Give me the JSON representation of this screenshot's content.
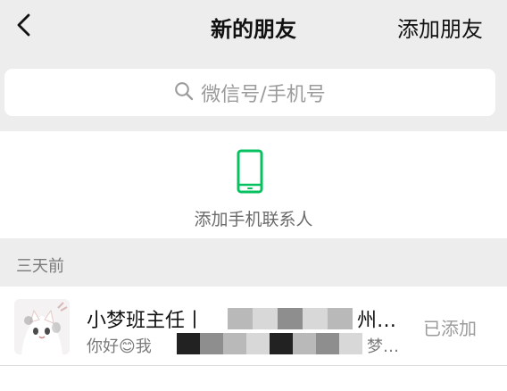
{
  "header": {
    "back_icon": "chevron-left-icon",
    "title": "新的朋友",
    "add_friend_label": "添加朋友"
  },
  "search": {
    "icon": "search-icon",
    "placeholder": "微信号/手机号"
  },
  "contacts_entry": {
    "icon": "phone-icon",
    "label": "添加手机联系人",
    "icon_color": "#07C160"
  },
  "section": {
    "title": "三天前"
  },
  "requests": [
    {
      "name_visible_start": "小梦班主任丨",
      "name_visible_end": "州…",
      "message_visible_start": "你好",
      "message_emoji": "😊",
      "message_after_emoji": "我",
      "message_visible_end": "梦…",
      "status": "已添加"
    }
  ]
}
